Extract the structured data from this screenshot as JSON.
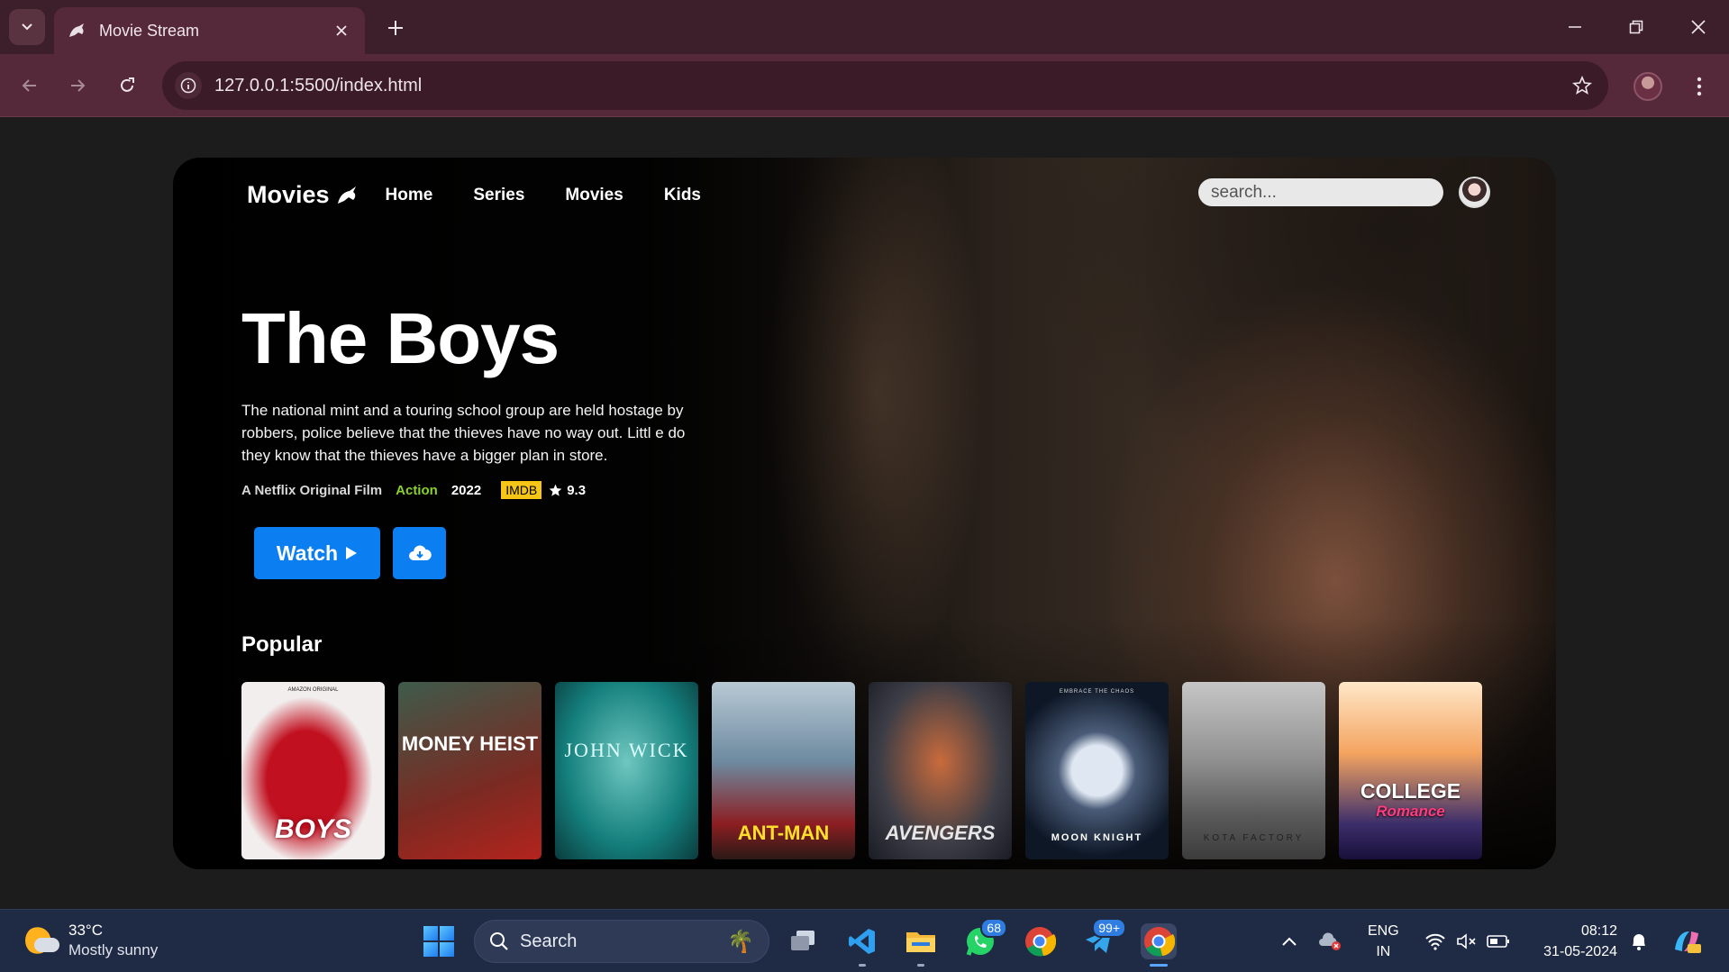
{
  "browser": {
    "tab_title": "Movie Stream",
    "url": "127.0.0.1:5500/index.html"
  },
  "site": {
    "logo": "Movies",
    "nav": [
      "Home",
      "Series",
      "Movies",
      "Kids"
    ],
    "search_placeholder": "search..."
  },
  "hero": {
    "title": "The Boys",
    "description": "The national mint and a touring school group are held hostage by robbers, police believe that the thieves have no way out. Littl e do they know that the thieves have a bigger plan in store.",
    "origin": "A Netflix Original Film",
    "genre": "Action",
    "year": "2022",
    "imdb_label": "IMDB",
    "rating": "9.3",
    "watch_label": "Watch",
    "colors": {
      "accent": "#0b7ff2",
      "genre": "#8ad12f",
      "imdb": "#f5c518"
    }
  },
  "popular": {
    "heading": "Popular",
    "posters": [
      {
        "title": "BOYS",
        "tag": "AMAZON ORIGINAL"
      },
      {
        "title": "MONEY HEIST"
      },
      {
        "title": "JOHN WICK"
      },
      {
        "title": "ANT-MAN"
      },
      {
        "title": "AVENGERS"
      },
      {
        "title": "MOON KNIGHT",
        "tag": "EMBRACE THE CHAOS"
      },
      {
        "title": "KOTA FACTORY"
      },
      {
        "title": "COLLEGE",
        "subtitle": "Romance"
      }
    ]
  },
  "taskbar": {
    "temperature": "33°C",
    "weather": "Mostly sunny",
    "search_label": "Search",
    "whatsapp_badge": "68",
    "telegram_badge": "99+",
    "lang_top": "ENG",
    "lang_bottom": "IN",
    "time": "08:12",
    "date": "31-05-2024"
  }
}
